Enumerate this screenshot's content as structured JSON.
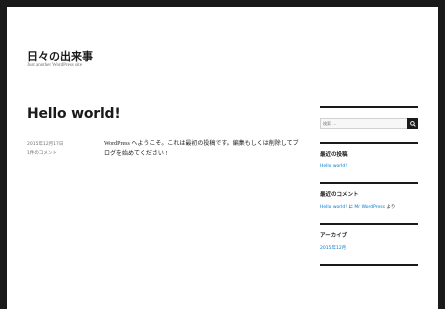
{
  "site": {
    "title": "日々の出来事",
    "description": "Just another WordPress site"
  },
  "post": {
    "title": "Hello world!",
    "date": "2015年12月17日",
    "comments": "1件のコメント",
    "content": "WordPress へようこそ。これは最初の投稿です。編集もしくは削除してブログを始めてください !"
  },
  "sidebar": {
    "search_placeholder": "検索 …",
    "recent_posts": {
      "title": "最近の投稿",
      "items": [
        "Hello world!"
      ]
    },
    "recent_comments": {
      "title": "最近のコメント",
      "author": "Mr WordPress",
      "connector": "に",
      "post_link": "Hello world!",
      "suffix": "より"
    },
    "archives": {
      "title": "アーカイブ",
      "items": [
        "2015年12月"
      ]
    }
  },
  "colors": {
    "link": "#007acc",
    "text": "#1a1a1a",
    "background": "#1a1a1a"
  }
}
